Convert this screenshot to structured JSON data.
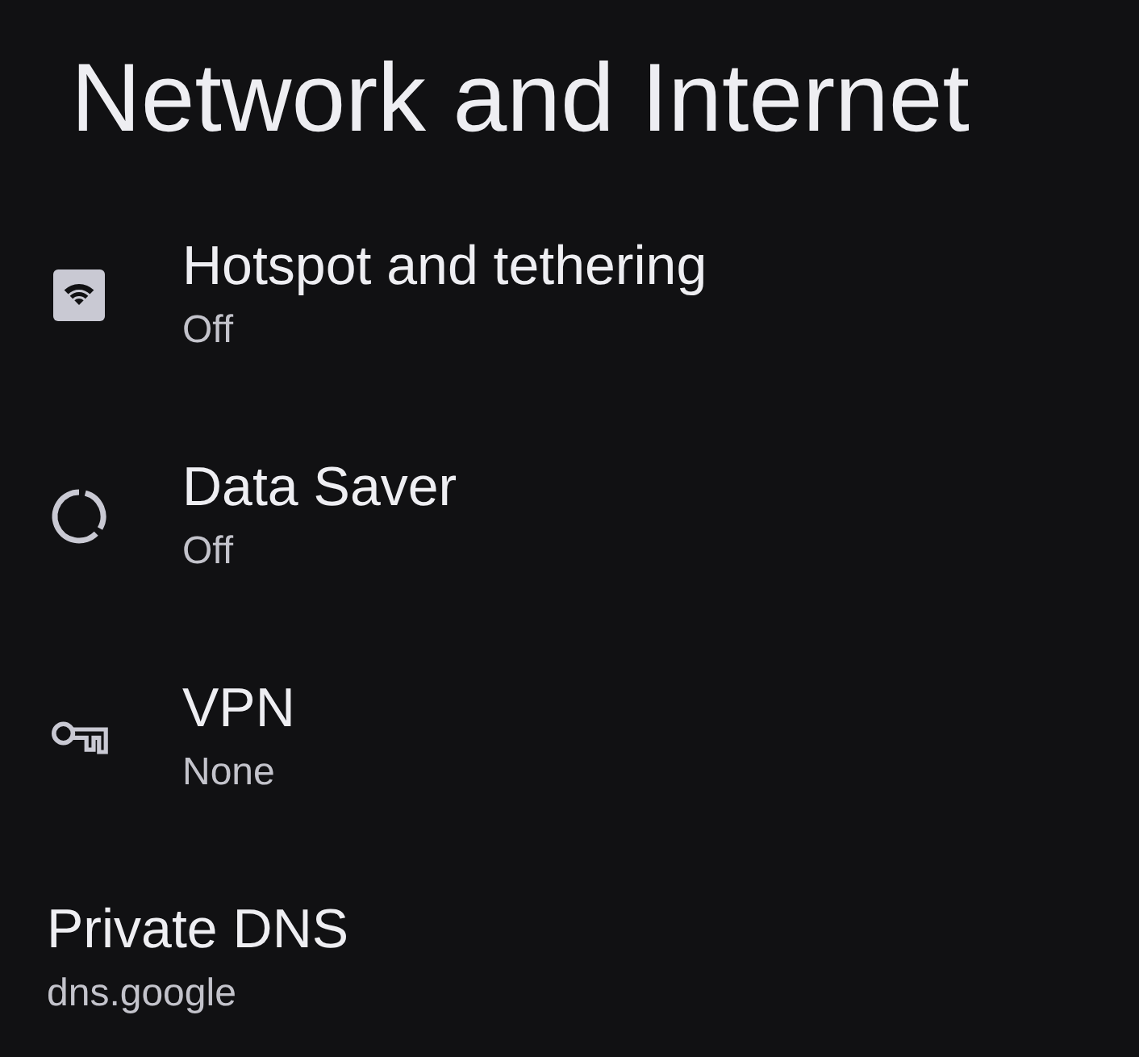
{
  "title": "Network and Internet",
  "items": [
    {
      "title": "Hotspot and tethering",
      "status": "Off"
    },
    {
      "title": "Data Saver",
      "status": "Off"
    },
    {
      "title": "VPN",
      "status": "None"
    }
  ],
  "private_dns": {
    "title": "Private DNS",
    "status": "dns.google"
  }
}
